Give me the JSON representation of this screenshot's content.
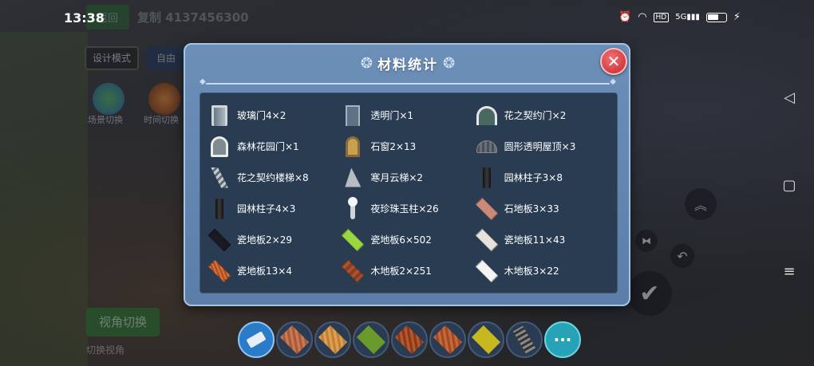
{
  "status_bar": {
    "time": "13:38",
    "icons": [
      "alarm-icon",
      "wifi-icon",
      "hd-icon",
      "5g-signal-icon",
      "battery-icon",
      "charging-icon"
    ]
  },
  "background_hud": {
    "top_green_label": "返回",
    "game_id": "复制 4137456300",
    "mode_button": "设计模式",
    "mode_button_2": "自由",
    "scene_switch": "场景切换",
    "time_switch": "时间切换",
    "view_switch": "视角切换",
    "bottom_note": "切换视角"
  },
  "dialog": {
    "title": "材料统计",
    "close_label": "✕",
    "items": [
      {
        "label": "玻璃门4×2",
        "icon": "glass-door-icon"
      },
      {
        "label": "透明门×1",
        "icon": "transparent-door-icon"
      },
      {
        "label": "花之契约门×2",
        "icon": "flower-contract-door-icon"
      },
      {
        "label": "森林花园门×1",
        "icon": "forest-garden-door-icon"
      },
      {
        "label": "石窗2×13",
        "icon": "stone-window-icon"
      },
      {
        "label": "圆形透明屋顶×3",
        "icon": "round-transparent-roof-icon"
      },
      {
        "label": "花之契约楼梯×8",
        "icon": "flower-contract-stairs-icon"
      },
      {
        "label": "寒月云梯×2",
        "icon": "cold-moon-ladder-icon"
      },
      {
        "label": "园林柱子3×8",
        "icon": "garden-pillar-icon"
      },
      {
        "label": "园林柱子4×3",
        "icon": "garden-pillar-icon"
      },
      {
        "label": "夜珍珠玉柱×26",
        "icon": "night-pearl-pillar-icon"
      },
      {
        "label": "石地板3×33",
        "icon": "stone-floor-icon"
      },
      {
        "label": "瓷地板2×29",
        "icon": "porcelain-floor-dark-icon"
      },
      {
        "label": "瓷地板6×502",
        "icon": "porcelain-floor-green-icon"
      },
      {
        "label": "瓷地板11×43",
        "icon": "porcelain-floor-white-icon"
      },
      {
        "label": "瓷地板13×4",
        "icon": "porcelain-floor-orange-icon"
      },
      {
        "label": "木地板2×251",
        "icon": "wood-floor-icon"
      },
      {
        "label": "木地板3×22",
        "icon": "wood-floor-white-icon"
      }
    ]
  },
  "toolbar": {
    "more_label": "···",
    "slots": [
      "eraser-icon",
      "floor-tile-icon",
      "floor-tile-icon",
      "floor-tile-icon",
      "floor-tile-icon",
      "floor-tile-icon",
      "floor-tile-icon",
      "stairs-icon"
    ]
  },
  "colors": {
    "dialog_bg": "#6c8fb8",
    "panel_bg": "#2a3c52",
    "close_red": "#c8262e"
  }
}
